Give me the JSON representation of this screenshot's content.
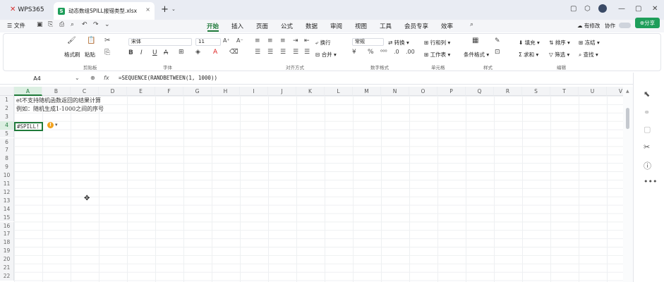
{
  "titlebar": {
    "brand": "WPS365",
    "tab_title": "动态数组SPILL报错类型.xlsx",
    "tab_close": "×",
    "add_tab": "+",
    "tab_menu": "⌄",
    "window_controls": [
      "▢",
      "⬡",
      "—",
      "▢",
      "✕"
    ]
  },
  "menubar": {
    "file": "文件",
    "items": [
      "开始",
      "插入",
      "页面",
      "公式",
      "数据",
      "审阅",
      "视图",
      "工具",
      "会员专享",
      "效率"
    ],
    "active": "开始",
    "weiyun": "有修改",
    "collab": "协作",
    "share": "分享"
  },
  "ribbon": {
    "clipboard": {
      "format_painter": "格式刷",
      "paste": "粘贴",
      "group": "剪贴板"
    },
    "font": {
      "name": "宋体",
      "size": "11",
      "group": "字体"
    },
    "alignment": {
      "wrap": "换行",
      "merge": "合并",
      "group": "对齐方式"
    },
    "number": {
      "format": "常规",
      "convert": "转换",
      "group": "数字格式"
    },
    "cells": {
      "row_col": "行和列",
      "worksheet": "工作表",
      "group": "单元格"
    },
    "styles": {
      "cond_format": "条件格式",
      "group": "样式"
    },
    "editing": {
      "fill": "填充",
      "sort": "排序",
      "freeze": "冻结",
      "sum": "求和",
      "filter": "筛选",
      "find": "查找",
      "group": "编辑"
    }
  },
  "formula_bar": {
    "name_box": "A4",
    "formula": "=SEQUENCE(RANDBETWEEN(1, 1000))"
  },
  "grid": {
    "columns": [
      "A",
      "B",
      "C",
      "D",
      "E",
      "F",
      "G",
      "H",
      "I",
      "J",
      "K",
      "L",
      "M",
      "N",
      "O",
      "P",
      "Q",
      "R",
      "S",
      "T",
      "U",
      "V"
    ],
    "rows": [
      "1",
      "2",
      "3",
      "4",
      "5",
      "6",
      "7",
      "8",
      "9",
      "10",
      "11",
      "12",
      "13",
      "14",
      "15",
      "16",
      "17",
      "18",
      "19",
      "20",
      "21",
      "22"
    ],
    "a1": "et不支持随机函数返回的结果计算",
    "a2": "例如：随机生成1-1000之间的序号",
    "a4": "#SPILL!",
    "warn": "!"
  }
}
